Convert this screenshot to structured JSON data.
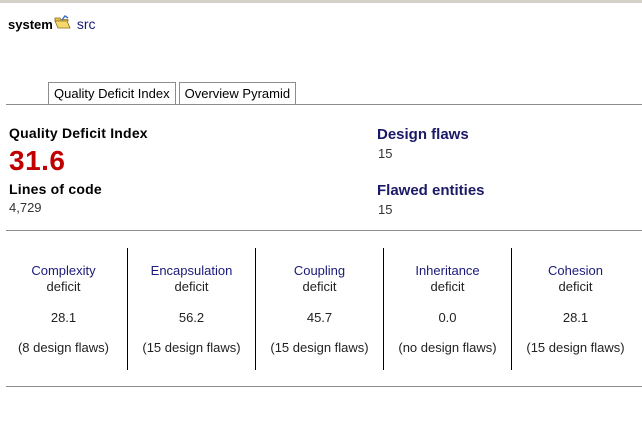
{
  "breadcrumb": {
    "root": "system",
    "current": "src"
  },
  "tabs": [
    {
      "label": "Quality Deficit Index",
      "active": true
    },
    {
      "label": "Overview Pyramid",
      "active": false
    }
  ],
  "summary": {
    "qdi_label": "Quality Deficit Index",
    "qdi_value": "31.6",
    "loc_label": "Lines of code",
    "loc_value": "4,729",
    "design_flaws_label": "Design flaws",
    "design_flaws_value": "15",
    "flawed_entities_label": "Flawed entities",
    "flawed_entities_value": "15"
  },
  "deficits": [
    {
      "name": "Complexity",
      "sub": "deficit",
      "value": "28.1",
      "flaws": "(8 design flaws)"
    },
    {
      "name": "Encapsulation",
      "sub": "deficit",
      "value": "56.2",
      "flaws": "(15 design flaws)"
    },
    {
      "name": "Coupling",
      "sub": "deficit",
      "value": "45.7",
      "flaws": "(15 design flaws)"
    },
    {
      "name": "Inheritance",
      "sub": "deficit",
      "value": "0.0",
      "flaws": "(no design flaws)"
    },
    {
      "name": "Cohesion",
      "sub": "deficit",
      "value": "28.1",
      "flaws": "(15 design flaws)"
    }
  ],
  "colors": {
    "qdi_red": "#c00000",
    "link_blue": "#1a1a7a"
  },
  "icons": {
    "folder": "folder-open-icon"
  }
}
